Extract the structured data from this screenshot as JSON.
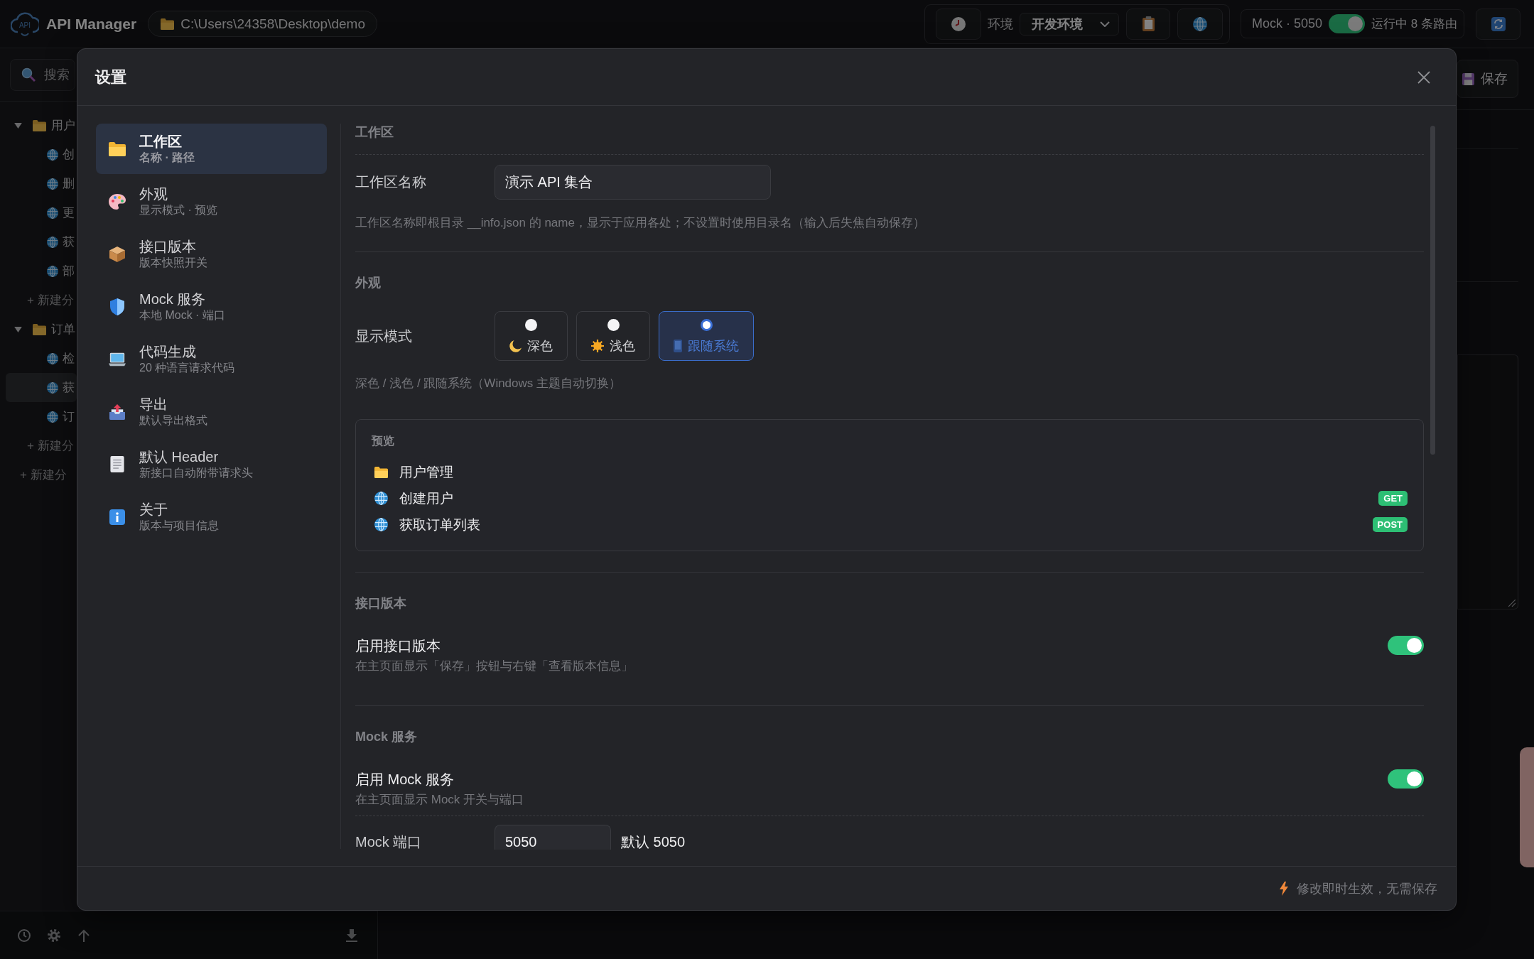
{
  "app_bar": {
    "logo_text": "API",
    "title": "API Manager",
    "path": "C:\\Users\\24358\\Desktop\\demo",
    "environment": {
      "label": "环境",
      "value": "开发环境"
    },
    "mock": {
      "label": "Mock · 5050",
      "on": true,
      "status": "运行中 8 条路由"
    }
  },
  "sidebar": {
    "search": {
      "placeholder": "搜索"
    },
    "tree": [
      {
        "kind": "folder",
        "label": "用户",
        "selected": false,
        "expanded": true,
        "children": [
          {
            "kind": "endpoint",
            "label": "创",
            "selected": false
          },
          {
            "kind": "endpoint",
            "label": "删",
            "selected": false
          },
          {
            "kind": "endpoint",
            "label": "更",
            "selected": false
          },
          {
            "kind": "endpoint",
            "label": "获",
            "selected": false
          },
          {
            "kind": "endpoint",
            "label": "部",
            "selected": false
          },
          {
            "kind": "add",
            "label": "+ 新建分"
          }
        ]
      },
      {
        "kind": "folder",
        "label": "订单",
        "selected": false,
        "expanded": true,
        "children": [
          {
            "kind": "endpoint",
            "label": "检",
            "selected": false
          },
          {
            "kind": "endpoint",
            "label": "获",
            "selected": true
          },
          {
            "kind": "endpoint",
            "label": "订",
            "selected": false
          },
          {
            "kind": "add",
            "label": "+ 新建分"
          }
        ]
      },
      {
        "kind": "add",
        "label": "+ 新建分"
      }
    ]
  },
  "editor": {
    "save_label": "保存"
  },
  "settings": {
    "title": "设置",
    "nav": [
      {
        "label": "工作区",
        "sub": "名称 · 路径",
        "selected": true
      },
      {
        "label": "外观",
        "sub": "显示模式 · 预览",
        "selected": false
      },
      {
        "label": "接口版本",
        "sub": "版本快照开关",
        "selected": false
      },
      {
        "label": "Mock 服务",
        "sub": "本地 Mock · 端口",
        "selected": false
      },
      {
        "label": "代码生成",
        "sub": "20 种语言请求代码",
        "selected": false
      },
      {
        "label": "导出",
        "sub": "默认导出格式",
        "selected": false
      },
      {
        "label": "默认 Header",
        "sub": "新接口自动附带请求头",
        "selected": false
      },
      {
        "label": "关于",
        "sub": "版本与项目信息",
        "selected": false
      }
    ],
    "sections": [
      {
        "kind": "workspace",
        "title": "工作区",
        "field": {
          "label": "工作区名称",
          "value": "演示 API 集合"
        },
        "hint": "工作区名称即根目录 __info.json 的 name，显示于应用各处；不设置时使用目录名（输入后失焦自动保存）"
      },
      {
        "kind": "appearance",
        "title": "外观",
        "mode_label": "显示模式",
        "modes": [
          {
            "label": "深色",
            "selected": false
          },
          {
            "label": "浅色",
            "selected": false
          },
          {
            "label": "跟随系统",
            "selected": true
          }
        ],
        "hint": "深色 / 浅色 / 跟随系统（Windows 主题自动切换）",
        "preview": {
          "title": "预览",
          "items": [
            {
              "kind": "folder",
              "label": "用户管理"
            },
            {
              "kind": "endpoint",
              "label": "创建用户",
              "method": "GET"
            },
            {
              "kind": "endpoint",
              "label": "获取订单列表",
              "method": "POST"
            }
          ]
        }
      },
      {
        "kind": "toggles",
        "title": "接口版本",
        "rows": [
          {
            "label": "启用接口版本",
            "hint": "在主页面显示「保存」按钮与右键「查看版本信息」",
            "on": true
          }
        ]
      },
      {
        "kind": "toggles",
        "title": "Mock 服务",
        "rows": [
          {
            "label": "启用 Mock 服务",
            "hint": "在主页面显示 Mock 开关与端口",
            "on": true
          }
        ],
        "port": {
          "label": "Mock 端口",
          "value": "5050",
          "note": "默认 5050"
        }
      }
    ],
    "footer": "修改即时生效，无需保存"
  }
}
